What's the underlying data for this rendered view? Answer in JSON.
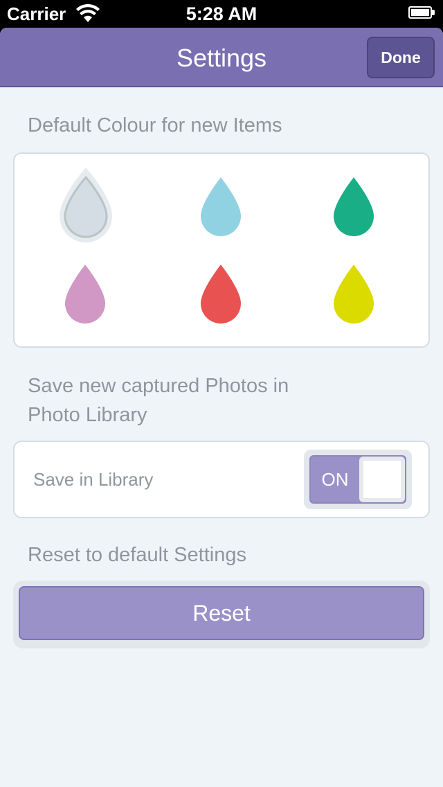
{
  "status_bar": {
    "carrier": "Carrier",
    "time": "5:28 AM",
    "wifi_icon": "wifi-icon",
    "battery_icon": "battery-icon"
  },
  "nav": {
    "title": "Settings",
    "done_label": "Done"
  },
  "colour_section": {
    "header": "Default Colour for new Items",
    "selected": "grey",
    "swatches": [
      {
        "name": "grey",
        "color": "#d3dde3",
        "selected": true
      },
      {
        "name": "light-blue",
        "color": "#91d2e2",
        "selected": false
      },
      {
        "name": "teal",
        "color": "#1aae86",
        "selected": false
      },
      {
        "name": "pink",
        "color": "#d197c5",
        "selected": false
      },
      {
        "name": "red",
        "color": "#e85352",
        "selected": false
      },
      {
        "name": "yellow",
        "color": "#dcdb00",
        "selected": false
      }
    ]
  },
  "photo_section": {
    "header_line1": "Save new captured Photos in",
    "header_line2": "Photo Library",
    "toggle_label": "Save in Library",
    "toggle_state": "ON"
  },
  "reset_section": {
    "header": "Reset to default Settings",
    "button_label": "Reset"
  },
  "colors": {
    "accent": "#7a6fb1",
    "button_fill": "#9b91c9",
    "background": "#eff4f8",
    "muted_text": "#8e969c"
  }
}
